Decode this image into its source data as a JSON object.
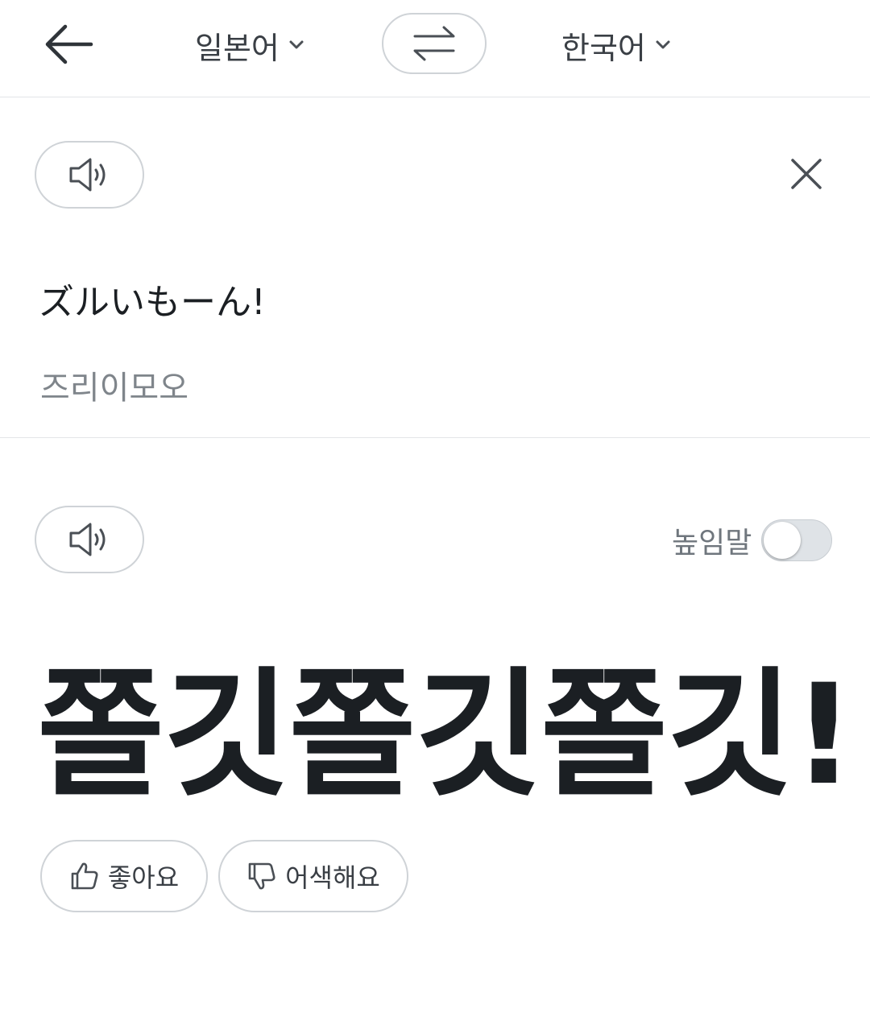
{
  "header": {
    "source_language": "일본어",
    "target_language": "한국어"
  },
  "source": {
    "text": "ズルいもーん!",
    "pronunciation": "즈리이모오"
  },
  "target": {
    "honorific_label": "높임말",
    "honorific_enabled": false,
    "result_text": "쫄깃쫄깃쫄깃!"
  },
  "feedback": {
    "like_label": "좋아요",
    "dislike_label": "어색해요"
  },
  "icons": {
    "back": "arrow-left-icon",
    "chevron": "chevron-down-icon",
    "swap": "swap-arrows-icon",
    "speaker": "speaker-icon",
    "close": "close-icon",
    "thumbs_up": "thumbs-up-icon",
    "thumbs_down": "thumbs-down-icon"
  },
  "colors": {
    "text_primary": "#1b1f23",
    "text_secondary": "#7f858b",
    "border": "#cfd3d7",
    "toggle_track": "#dfe3e7"
  }
}
